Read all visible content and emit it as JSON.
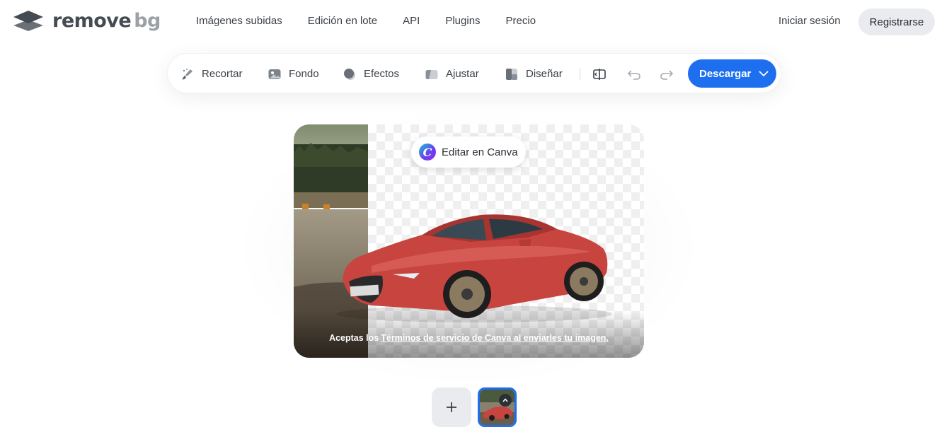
{
  "header": {
    "logo": {
      "word1": "remove",
      "word2": "bg"
    },
    "nav": [
      "Imágenes subidas",
      "Edición en lote",
      "API",
      "Plugins",
      "Precio"
    ],
    "login_label": "Iniciar sesión",
    "register_label": "Registrarse"
  },
  "toolbar": {
    "tools": [
      {
        "label": "Recortar",
        "icon": "brush-icon"
      },
      {
        "label": "Fondo",
        "icon": "image-icon"
      },
      {
        "label": "Efectos",
        "icon": "circle-effects-icon"
      },
      {
        "label": "Ajustar",
        "icon": "adjust-icon"
      },
      {
        "label": "Diseñar",
        "icon": "layout-icon"
      }
    ],
    "compare_icon": "compare-icon",
    "undo_icon": "undo-icon",
    "redo_icon": "redo-icon",
    "download_label": "Descargar",
    "accent": "#1e6ef0"
  },
  "canvas": {
    "canva_button_label": "Editar en Canva",
    "terms_prefix": "Aceptas los",
    "terms_link": "Términos de servicio de Canva al enviarles tu imagen."
  },
  "gallery": {
    "add_icon": "plus-icon",
    "thumb_badge_icon": "chevron-up-icon"
  }
}
